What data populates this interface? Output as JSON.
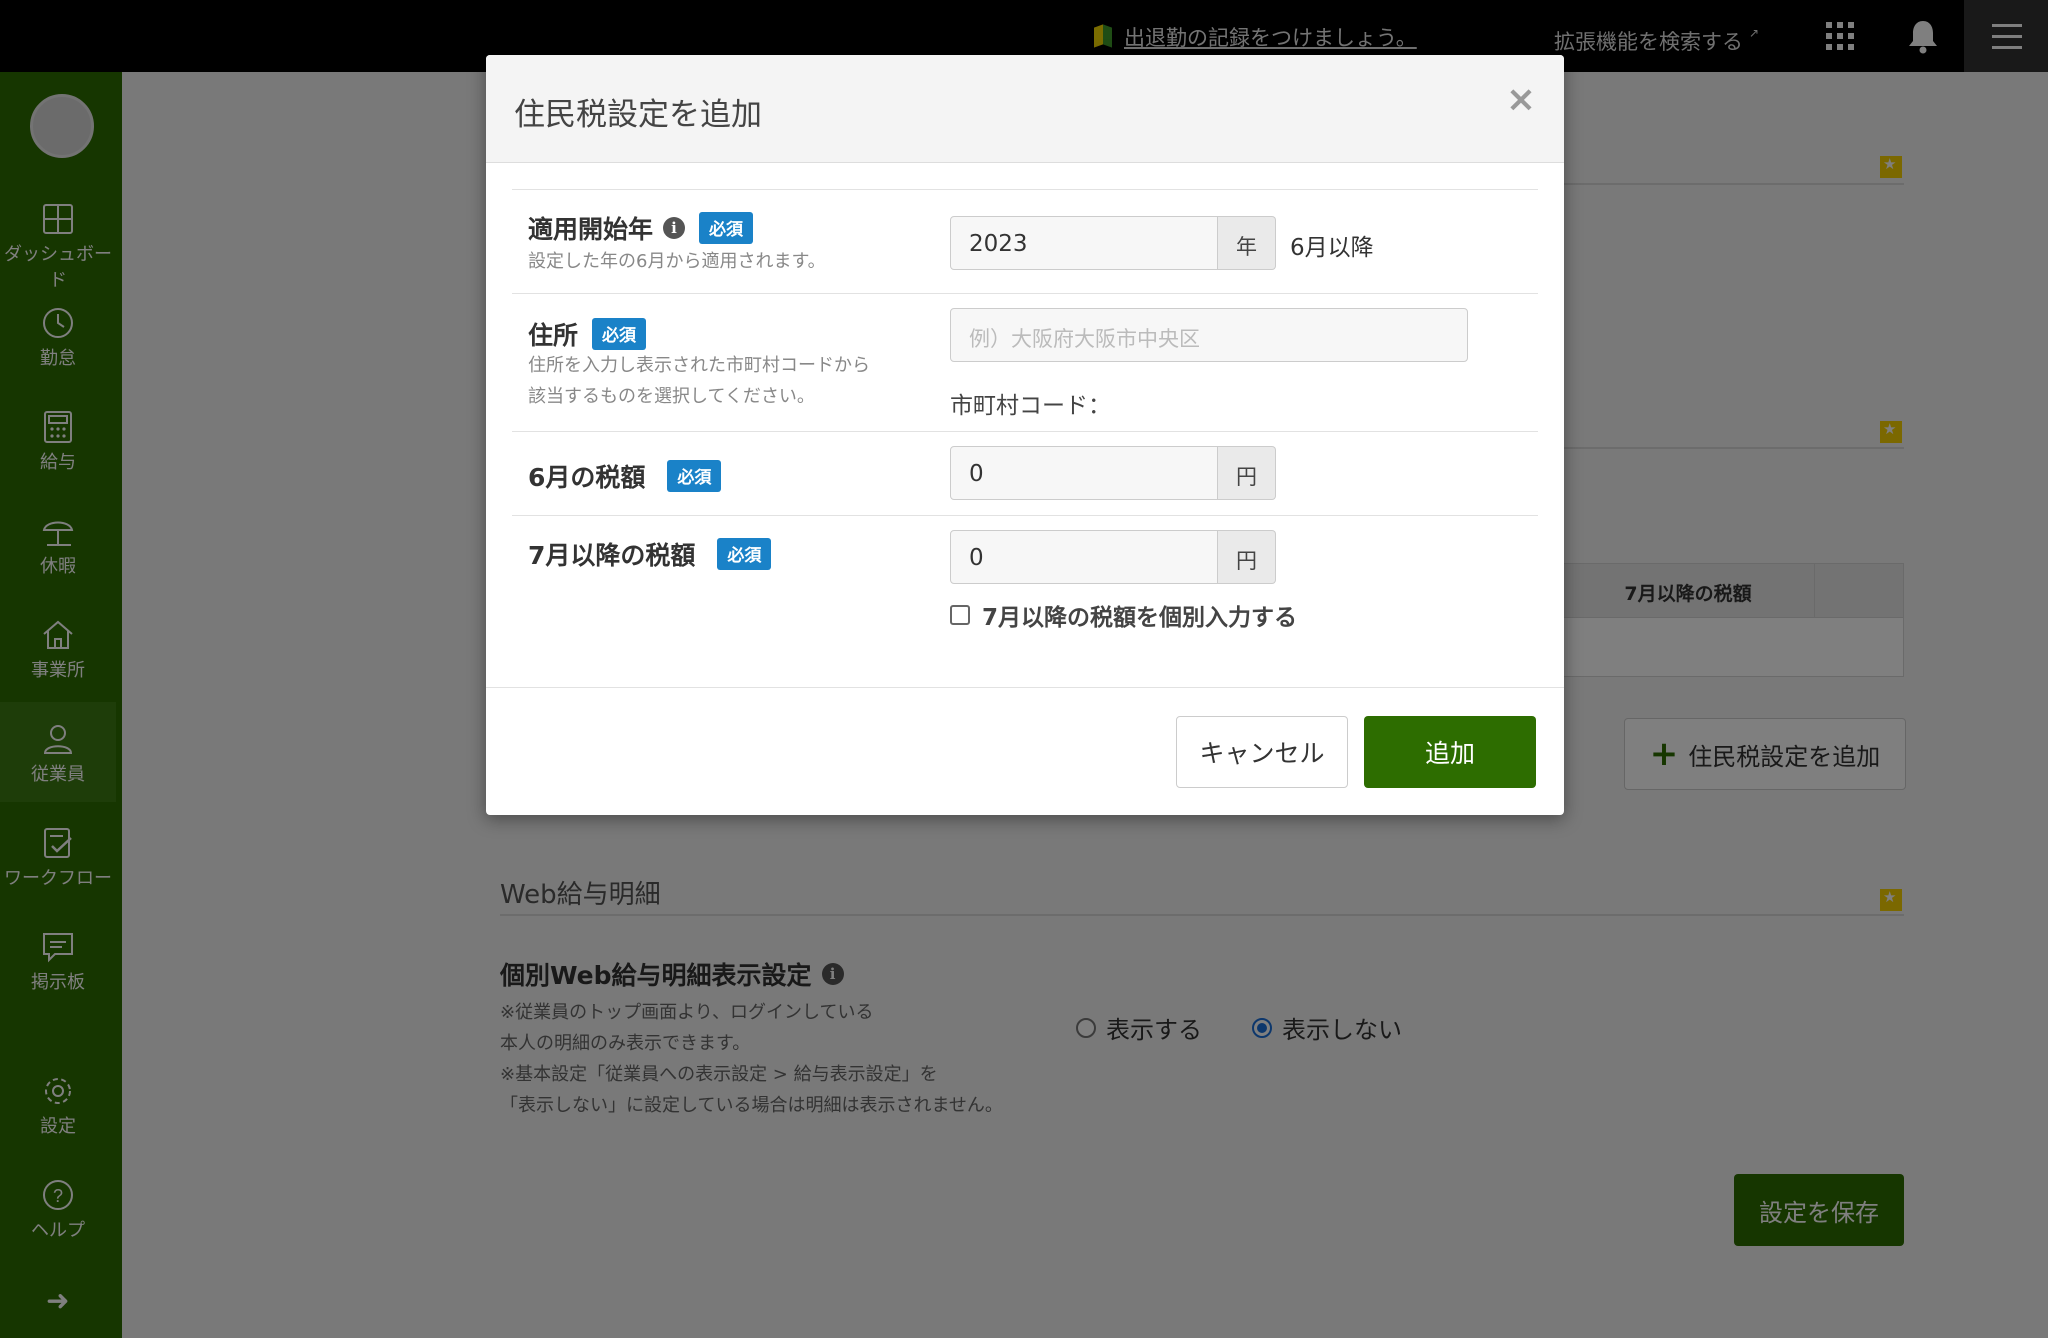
{
  "topbar": {
    "notice_text": "出退勤の記録をつけましょう。",
    "extension_search": "拡張機能を検索する"
  },
  "sidebar": {
    "items": [
      {
        "label": "ダッシュボード",
        "icon": "dashboard-icon"
      },
      {
        "label": "勤怠",
        "icon": "clock-icon"
      },
      {
        "label": "給与",
        "icon": "calculator-icon"
      },
      {
        "label": "休暇",
        "icon": "umbrella-icon"
      },
      {
        "label": "事業所",
        "icon": "home-icon"
      },
      {
        "label": "従業員",
        "icon": "person-icon"
      },
      {
        "label": "ワークフロー",
        "icon": "checklist-icon"
      },
      {
        "label": "掲示板",
        "icon": "chat-icon"
      },
      {
        "label": "設定",
        "icon": "gear-icon"
      },
      {
        "label": "ヘルプ",
        "icon": "help-icon"
      }
    ],
    "active_index": 5
  },
  "background": {
    "table_header": "7月以降の税額",
    "add_setting_button": "住民税設定を追加",
    "web_section_title": "Web給与明細",
    "web_setting_title": "個別Web給与明細表示設定",
    "notes": [
      "※従業員のトップ画面より、ログインしている",
      "本人の明細のみ表示できます。",
      "※基本設定「従業員への表示設定 > 給与表示設定」を",
      "「表示しない」に設定している場合は明細は表示されません。"
    ],
    "radio_show": "表示する",
    "radio_hide": "表示しない",
    "radio_selected": "表示しない",
    "save_button": "設定を保存"
  },
  "modal": {
    "title": "住民税設定を追加",
    "close_symbol": "×",
    "required_badge": "必須",
    "start_year": {
      "label": "適用開始年",
      "help": "設定した年の6月から適用されます。",
      "value": "2023",
      "unit": "年",
      "suffix": "6月以降"
    },
    "address": {
      "label": "住所",
      "help_line1": "住所を入力し表示された市町村コードから",
      "help_line2": "該当するものを選択してください。",
      "placeholder": "例）大阪府大阪市中央区",
      "city_code_label": "市町村コード："
    },
    "june_tax": {
      "label": "6月の税額",
      "value": "0",
      "unit": "円"
    },
    "july_tax": {
      "label": "7月以降の税額",
      "value": "0",
      "unit": "円",
      "checkbox_label": "7月以降の税額を個別入力する",
      "checkbox_checked": false
    },
    "cancel_button": "キャンセル",
    "add_button": "追加"
  }
}
